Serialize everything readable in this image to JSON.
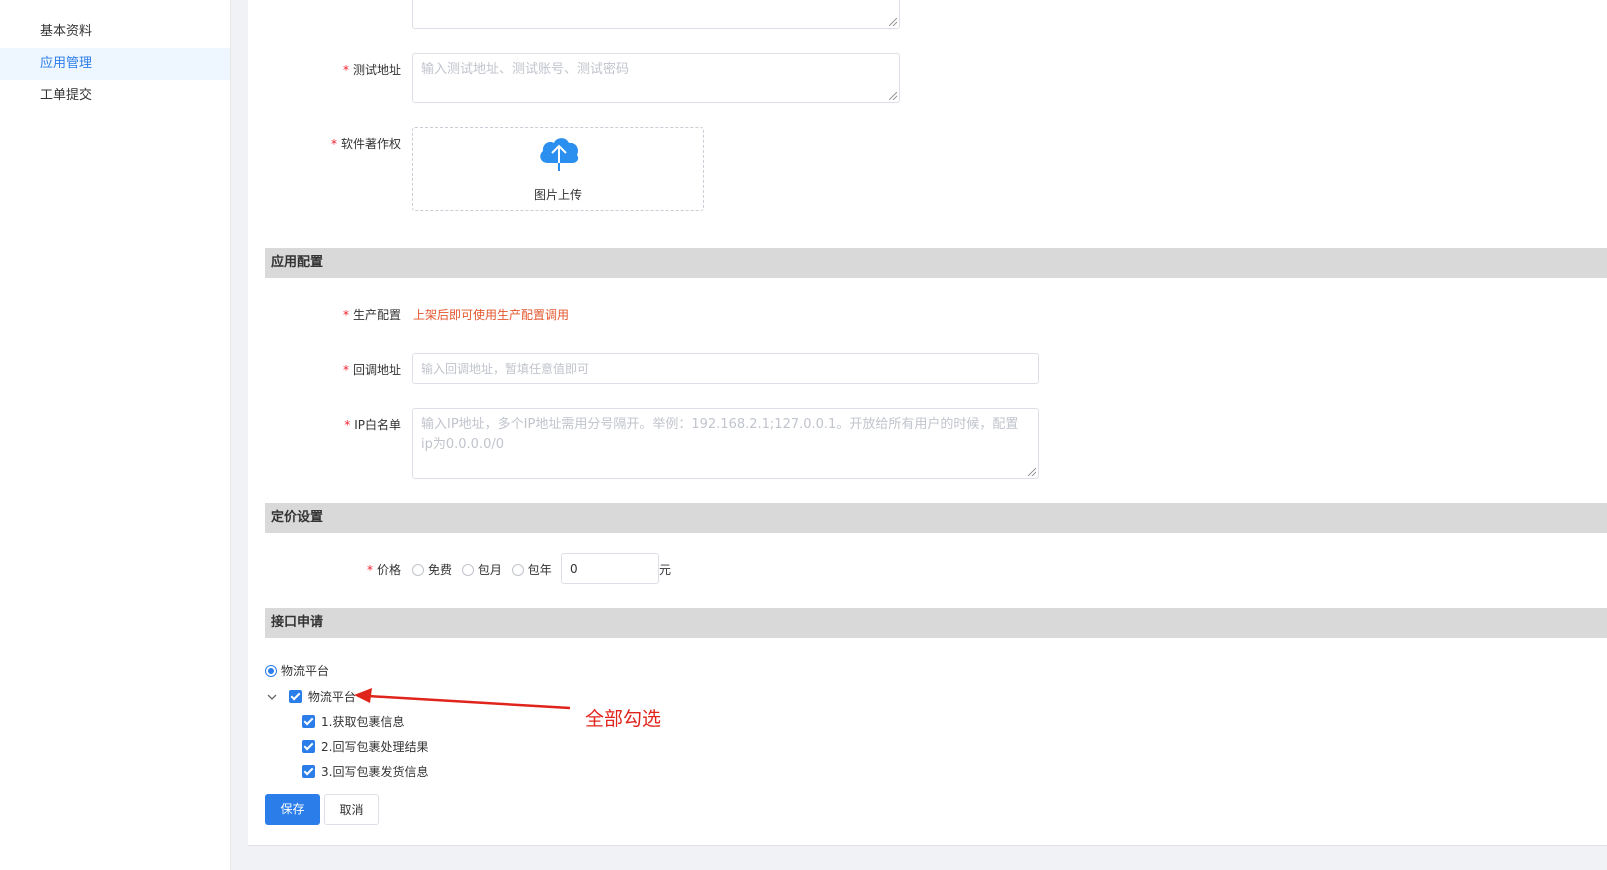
{
  "sidebar": {
    "items": [
      {
        "label": "基本资料"
      },
      {
        "label": "应用管理"
      },
      {
        "label": "工单提交"
      }
    ]
  },
  "form": {
    "test_address": {
      "label": "测试地址",
      "placeholder": "输入测试地址、测试账号、测试密码"
    },
    "software_copyright": {
      "label": "软件著作权",
      "upload_text": "图片上传"
    }
  },
  "sections": {
    "app_config": {
      "title": "应用配置",
      "production_label": "生产配置",
      "production_notice": "上架后即可使用生产配置调用",
      "callback_label": "回调地址",
      "callback_placeholder": "输入回调地址，暂填任意值即可",
      "ip_label": "IP白名单",
      "ip_placeholder": "输入IP地址，多个IP地址需用分号隔开。举例：192.168.2.1;127.0.0.1。开放给所有用户的时候，配置ip为0.0.0.0/0"
    },
    "pricing": {
      "title": "定价设置",
      "price_label": "价格",
      "options": [
        "免费",
        "包月",
        "包年"
      ],
      "value": "0",
      "unit": "元"
    },
    "api": {
      "title": "接口申请",
      "platform_radio": "物流平台",
      "tree_parent": "物流平台",
      "tree_children": [
        "1.获取包裹信息",
        "2.回写包裹处理结果",
        "3.回写包裹发货信息"
      ]
    }
  },
  "buttons": {
    "save": "保存",
    "cancel": "取消"
  },
  "annotation": {
    "text": "全部勾选",
    "color": "#e0241b"
  },
  "colors": {
    "primary": "#2b7de9",
    "required": "#f5222d",
    "section_bg": "#d9d9d9",
    "notice": "#e4572e"
  }
}
